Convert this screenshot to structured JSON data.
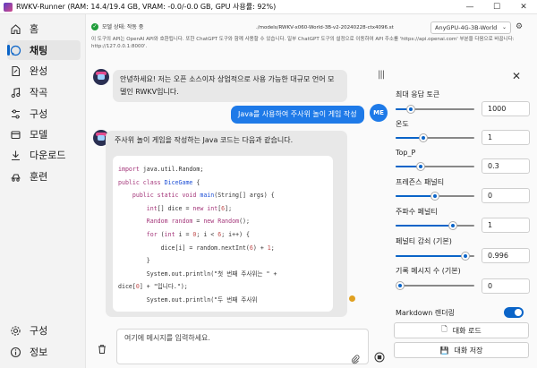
{
  "window": {
    "title": "RWKV-Runner (RAM: 14.4/19.4 GB, VRAM: -0.0/-0.0 GB, GPU 사용률: 92%)",
    "controls": [
      "—",
      "☐",
      "✕"
    ]
  },
  "sidebar": {
    "items": [
      {
        "label": "홈",
        "icon": "home-icon"
      },
      {
        "label": "채팅",
        "icon": "chat-icon",
        "active": true
      },
      {
        "label": "완성",
        "icon": "document-edit-icon"
      },
      {
        "label": "작곡",
        "icon": "music-note-icon"
      },
      {
        "label": "구성",
        "icon": "settings-sliders-icon"
      },
      {
        "label": "모델",
        "icon": "cube-icon"
      },
      {
        "label": "다운로드",
        "icon": "download-icon"
      },
      {
        "label": "훈련",
        "icon": "train-icon"
      }
    ],
    "bottom_items": [
      {
        "label": "구성",
        "icon": "gear-icon"
      },
      {
        "label": "정보",
        "icon": "info-icon"
      }
    ]
  },
  "header": {
    "status": "모델 상태: 작동 중",
    "model_path": "./models/RWKV-x060-World-3B-v2-20240228-ctx4096.st",
    "model_select": "AnyGPU-4G-3B-World",
    "notice": "이 도구의 API는 OpenAI API와 호환됩니다. 또한 ChatGPT 도구와 함께 사용할 수 있습니다. 일부 ChatGPT 도구의 설정으로 이동하여 API 주소를 'https://api.openai.com' 부분을 다음으로 바꿉니다: http://127.0.0.1:8000'."
  },
  "messages": [
    {
      "role": "assistant",
      "text": "안녕하세요! 저는 오픈 소스이자 상업적으로 사용 가능한 대규모 언어 모델인 RWKV입니다."
    },
    {
      "role": "user",
      "badge": "ME",
      "text": "Java를 사용하여 주사위 놀이 게임 작성"
    },
    {
      "role": "assistant",
      "text": "주사위 놀이 게임을 작성하는 Java 코드는 다음과 같습니다."
    }
  ],
  "code_lines": [
    [
      [
        "kw",
        "import"
      ],
      [
        "p",
        " java.util.Random;"
      ]
    ],
    [
      [
        "kw",
        "public class"
      ],
      [
        "p",
        " "
      ],
      [
        "ty",
        "DiceGame"
      ],
      [
        "p",
        " {"
      ]
    ],
    [
      [
        "p",
        "    "
      ],
      [
        "kw",
        "public static void"
      ],
      [
        "p",
        " "
      ],
      [
        "ty",
        "main"
      ],
      [
        "p",
        "(String[] args) {"
      ]
    ],
    [
      [
        "p",
        "        "
      ],
      [
        "kw",
        "int"
      ],
      [
        "p",
        "[] dice = "
      ],
      [
        "kw",
        "new int"
      ],
      [
        "p",
        "["
      ],
      [
        "num",
        "6"
      ],
      [
        "p",
        "];"
      ]
    ],
    [
      [
        "p",
        "        "
      ],
      [
        "kw",
        "Random"
      ],
      [
        "p",
        " "
      ],
      [
        "kw",
        "random"
      ],
      [
        "p",
        " = "
      ],
      [
        "kw",
        "new"
      ],
      [
        "p",
        " "
      ],
      [
        "kw",
        "Random"
      ],
      [
        "p",
        "();"
      ]
    ],
    [
      [
        "p",
        "        "
      ],
      [
        "kw",
        "for"
      ],
      [
        "p",
        " ("
      ],
      [
        "kw",
        "int"
      ],
      [
        "p",
        " i = "
      ],
      [
        "num",
        "0"
      ],
      [
        "p",
        "; i < "
      ],
      [
        "num",
        "6"
      ],
      [
        "p",
        "; i++) {"
      ]
    ],
    [
      [
        "p",
        "            dice[i] = random.nextInt("
      ],
      [
        "num",
        "6"
      ],
      [
        "p",
        ") + "
      ],
      [
        "num",
        "1"
      ],
      [
        "p",
        ";"
      ]
    ],
    [
      [
        "p",
        "        }"
      ]
    ],
    [
      [
        "p",
        "        System.out.println(\"첫 번째 주사위는 \" +"
      ]
    ],
    [
      [
        "p",
        "dice["
      ],
      [
        "num",
        "0"
      ],
      [
        "p",
        "] + \"입니다.\");"
      ]
    ],
    [
      [
        "p",
        "        System.out.println(\"두 번째 주사위"
      ]
    ]
  ],
  "input": {
    "placeholder": "여기에 메시지를 입력하세요."
  },
  "settings": {
    "params": [
      {
        "label": "최대 응답 토큰",
        "value": "1000",
        "fraction": 0.16
      },
      {
        "label": "온도",
        "value": "1",
        "fraction": 0.33
      },
      {
        "label": "Top_P",
        "value": "0.3",
        "fraction": 0.3
      },
      {
        "label": "프레즌스 패널티",
        "value": "0",
        "fraction": 0.5
      },
      {
        "label": "주파수 페널티",
        "value": "1",
        "fraction": 0.75
      },
      {
        "label": "페널티 감쇠 (기본)",
        "value": "0.996",
        "fraction": 0.93
      },
      {
        "label": "기록 메시지 수 (기본)",
        "value": "0",
        "fraction": 0.0
      }
    ],
    "markdown_label": "Markdown 렌더링",
    "markdown_on": true,
    "load_button": "대화 로드",
    "save_button": "대화 저장"
  },
  "colors": {
    "accent": "#0a64c8",
    "user_bubble": "#1e7ae8",
    "status_ok": "#1f9d3a"
  }
}
